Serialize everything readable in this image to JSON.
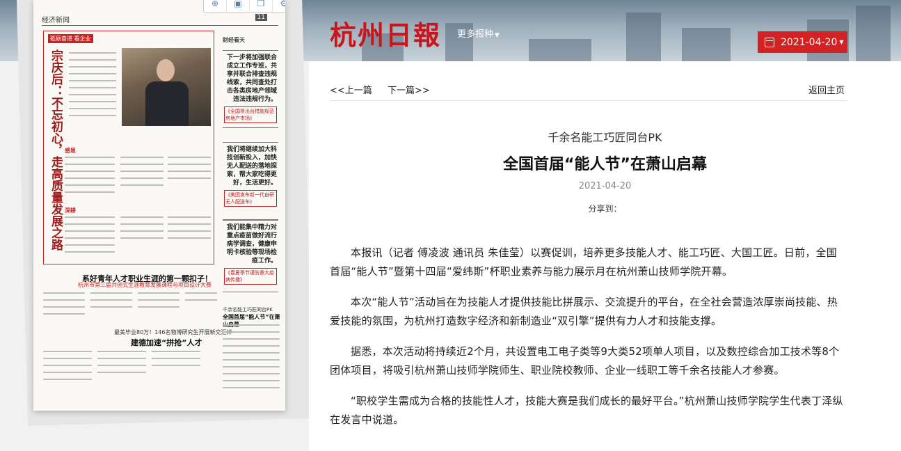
{
  "header": {
    "logo": "杭州日報",
    "more_papers": "更多报种",
    "date": "2021-04-20",
    "accent": "#d42121"
  },
  "newspaper": {
    "section": "经济新闻",
    "page_badge": "11",
    "story1_tag": "砥砺奋进 看企业",
    "story1_headline": "宗庆后：不忘初心，走高质量发展之路",
    "story1_sub1": "感恩",
    "story1_sub2": "深耕",
    "right_col_tag": "财经看天",
    "promo1": "下一步将加强联合成立工作专班，共享并联合排查违规线索，共同查处打击各类房地产领域违法违规行为。",
    "promo1_link": "《全国将出台措施规范房地产市场》",
    "promo2": "我们将继续加大科技创新投入，加快无人配送的落地探索，帮大家吃得更好，生活更好。",
    "promo2_link": "《美团发布新一代自研无人配送车》",
    "promo3": "我们能集中精力对重点疫苗做好流行病学调查，健康申明卡核验等现场检疫工作。",
    "promo3_link": "《春夏季节谨防重大疫病传播》",
    "story2_title": "系好青年人才职业生涯的第一颗扣子！",
    "story2_sub": "杭州市第三届共创式生涯教育发展课程与项目设计大赛",
    "story3_title": "最美毕业80万！146名物博研究生开展新交汇样",
    "story3_main": "建德加速“拼抢”人才",
    "story4_title": "千余名能工巧匠同台PK",
    "story4_main": "全国首届“能人节”在萧山启幕"
  },
  "toolbar": {
    "icons": [
      "zoom-icon",
      "save-icon",
      "copy-icon",
      "settings-icon"
    ]
  },
  "article": {
    "prev": "<<上一篇",
    "next": "下一篇>>",
    "back": "返回主页",
    "kicker": "千余名能工巧匠同台PK",
    "title": "全国首届“能人节”在萧山启幕",
    "date": "2021-04-20",
    "share": "分享到：",
    "paragraphs": [
      "本报讯（记者 傅凌波 通讯员 朱佳莹）以赛促训，培养更多技能人才、能工巧匠、大国工匠。日前，全国首届“能人节”暨第十四届“爱纬斯”杯职业素养与能力展示月在杭州萧山技师学院开幕。",
      "本次“能人节”活动旨在为技能人才提供技能比拼展示、交流提升的平台，在全社会营造浓厚崇尚技能、热爱技能的氛围，为杭州打造数字经济和新制造业“双引擎”提供有力人才和技能支撑。",
      "据悉，本次活动将持续近2个月，共设置电工电子类等9大类52项单人项目，以及数控综合加工技术等8个团体项目，将吸引杭州萧山技师学院师生、职业院校教师、企业一线职工等千余名技能人才参赛。",
      "“职校学生需成为合格的技能性人才，技能大赛是我们成长的最好平台。”杭州萧山技师学院学生代表丁泽纵在发言中说道。"
    ]
  }
}
